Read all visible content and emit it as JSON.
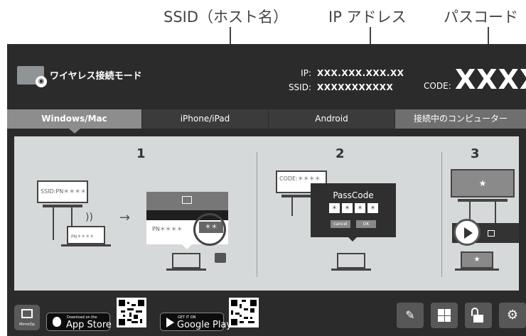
{
  "annotations": {
    "ssid_label": "SSID（ホスト名）",
    "ip_label": "IP アドレス",
    "passcode_label": "パスコード"
  },
  "header": {
    "title": "ワイヤレス接続モード",
    "ip_key": "IP:",
    "ip_value": "XXX.XXX.XXX.XX",
    "ssid_key": "SSID:",
    "ssid_value": "XXXXXXXXXXX",
    "code_key": "CODE:",
    "code_value": "XXXX"
  },
  "tabs": [
    {
      "label": "Windows/Mac",
      "active": true
    },
    {
      "label": "iPhone/iPad",
      "active": false
    },
    {
      "label": "Android",
      "active": false
    },
    {
      "label": "接続中のコンピューター",
      "active": false
    }
  ],
  "steps": {
    "step1": {
      "number": "1",
      "ssid_text": "SSID:PN＊＊＊＊",
      "laptop_text": "PN＊＊＊＊",
      "popup_item": "PN＊＊＊＊",
      "popup_pass": "＊＊"
    },
    "step2": {
      "number": "2",
      "code_text": "CODE:＊＊＊＊",
      "dialog_title": "PassCode",
      "dialog_digits": [
        "＊",
        "＊",
        "＊",
        "＊"
      ],
      "cancel_label": "cancel",
      "ok_label": "OK"
    },
    "step3": {
      "number": "3",
      "star": "★"
    }
  },
  "footer": {
    "app_label": "MirrorOp",
    "appstore_small": "Download on the",
    "appstore_big": "App Store",
    "googleplay_small": "GET IT ON",
    "googleplay_big": "Google Play"
  },
  "colors": {
    "screen_bg": "#2b2b2b",
    "content_bg": "#d6d9da",
    "tab_active": "#8d8d8d",
    "tool_button": "#575757"
  }
}
